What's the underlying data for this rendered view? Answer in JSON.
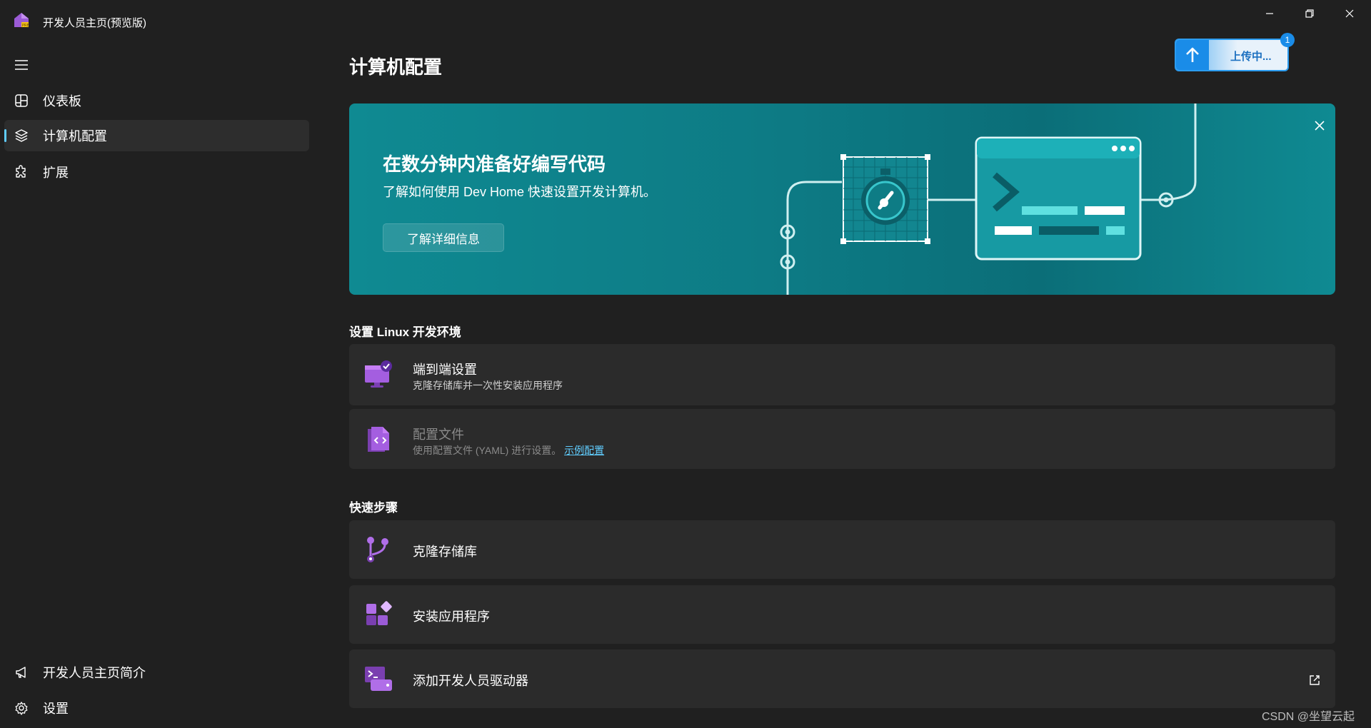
{
  "window": {
    "title": "开发人员主页(预览版)",
    "app_icon": "dev-home-house-icon"
  },
  "sidebar": {
    "items": [
      {
        "label": "仪表板",
        "icon": "dashboard-icon"
      },
      {
        "label": "计算机配置",
        "icon": "layers-icon",
        "active": true
      },
      {
        "label": "扩展",
        "icon": "puzzle-icon"
      }
    ],
    "footer": [
      {
        "label": "开发人员主页简介",
        "icon": "megaphone-icon"
      },
      {
        "label": "设置",
        "icon": "gear-icon"
      }
    ]
  },
  "main": {
    "title": "计算机配置",
    "upload": {
      "label": "上传中...",
      "badge": "1"
    },
    "banner": {
      "title": "在数分钟内准备好编写代码",
      "description": "了解如何使用 Dev Home 快速设置开发计算机。",
      "button": "了解详细信息"
    },
    "section_linux": {
      "header": "设置 Linux 开发环境",
      "cards": [
        {
          "title": "端到端设置",
          "subtitle": "克隆存储库并一次性安装应用程序",
          "icon": "monitor-check-icon"
        },
        {
          "title": "配置文件",
          "subtitle": "使用配置文件 (YAML) 进行设置。",
          "link": "示例配置",
          "icon": "code-file-icon",
          "disabled": true
        }
      ]
    },
    "section_quick": {
      "header": "快速步骤",
      "cards": [
        {
          "title": "克隆存储库",
          "icon": "git-branch-icon"
        },
        {
          "title": "安装应用程序",
          "icon": "apps-icon"
        },
        {
          "title": "添加开发人员驱动器",
          "icon": "dev-drive-icon",
          "external": true
        }
      ]
    }
  },
  "watermark": "CSDN @坐望云起",
  "colors": {
    "background": "#202020",
    "card": "#2b2b2b",
    "accent": "#60cdff",
    "banner": "#0d7a84",
    "purple": "#9b5bd6"
  }
}
